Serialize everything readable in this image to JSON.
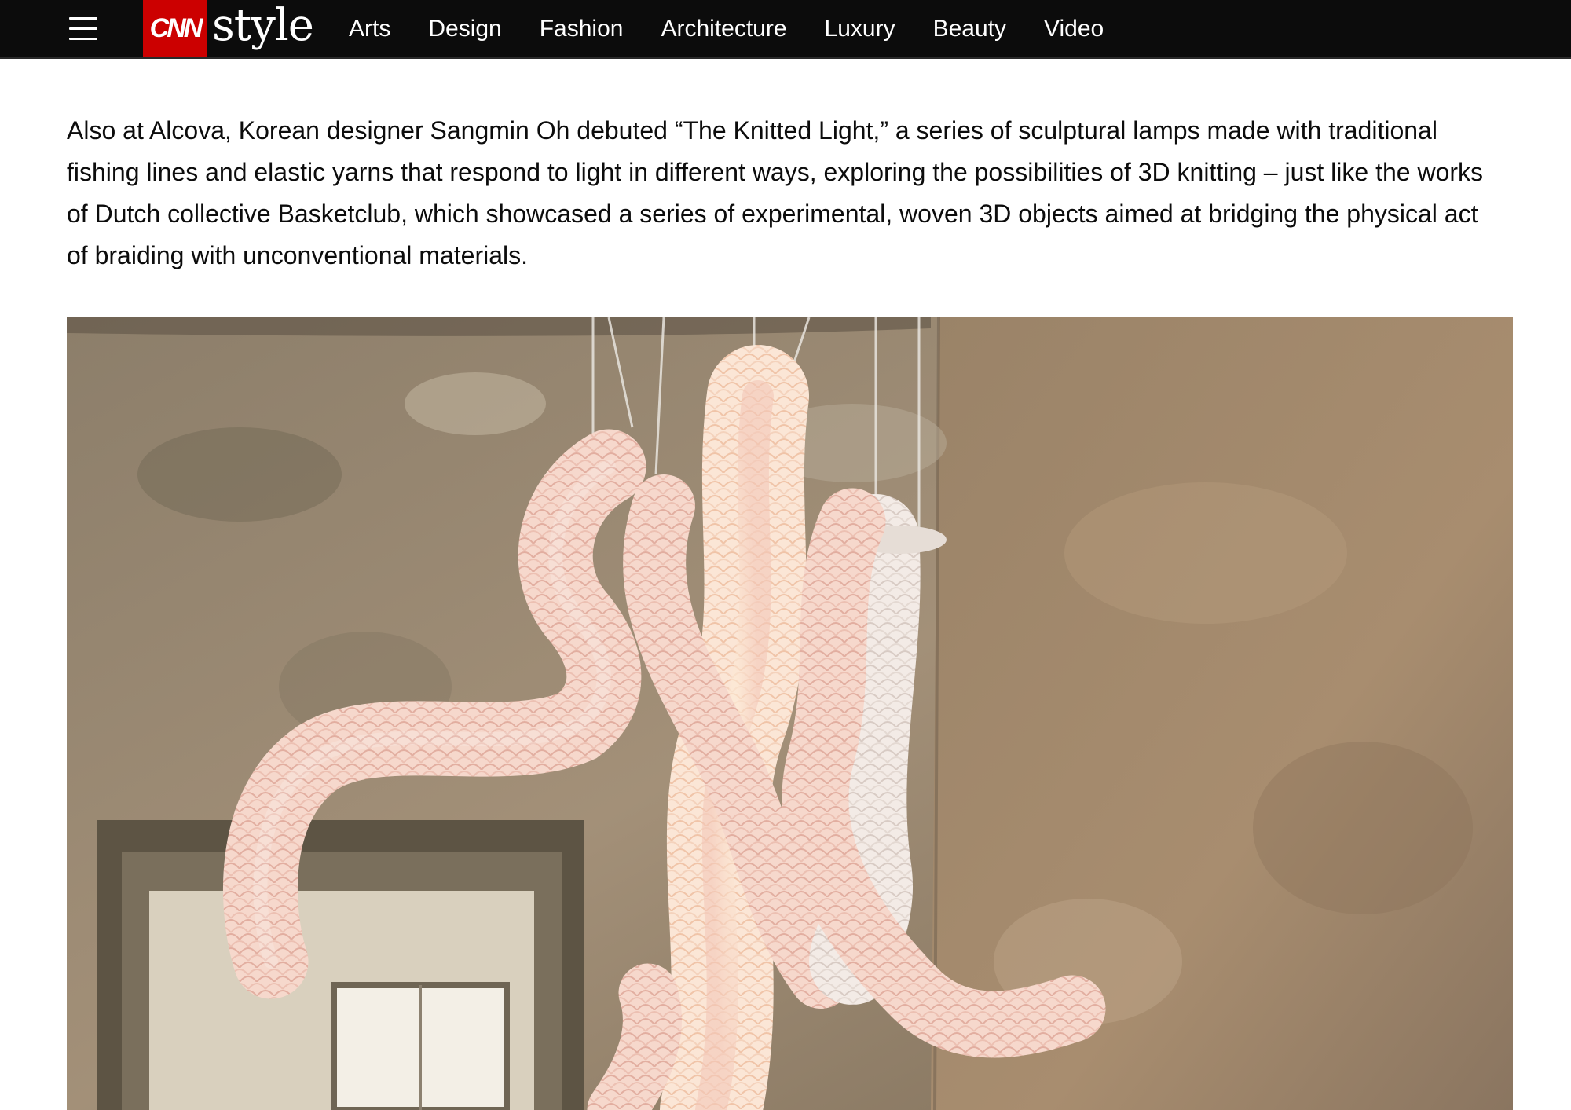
{
  "header": {
    "menu_icon": "hamburger-menu-icon",
    "logo": {
      "brand": "CNN",
      "section": "style"
    },
    "nav_items": [
      {
        "label": "Arts"
      },
      {
        "label": "Design"
      },
      {
        "label": "Fashion"
      },
      {
        "label": "Architecture"
      },
      {
        "label": "Luxury"
      },
      {
        "label": "Beauty"
      },
      {
        "label": "Video"
      }
    ],
    "colors": {
      "bar": "#0c0c0c",
      "brand_red": "#cc0000",
      "text": "#ffffff"
    }
  },
  "article": {
    "paragraph": "Also at Alcova, Korean designer Sangmin Oh debuted “The Knitted Light,” a series of sculptural lamps made with traditional fishing lines and elastic yarns that respond to light in different ways, exploring the possibilities of 3D knitting – just like the works of Dutch collective Basketclub, which showcased a series of experimental, woven 3D objects aimed at bridging the physical act of braiding with unconventional materials."
  }
}
